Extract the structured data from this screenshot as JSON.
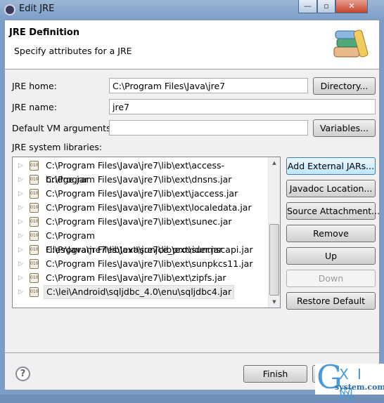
{
  "window": {
    "title": "Edit JRE",
    "controls": [
      "minimize",
      "maximize",
      "close"
    ]
  },
  "header": {
    "title": "JRE Definition",
    "subtitle": "Specify attributes for a JRE",
    "icon": "books-icon"
  },
  "form": {
    "jre_home": {
      "label": "JRE home:",
      "value": "C:\\Program Files\\Java\\jre7",
      "button": "Directory..."
    },
    "jre_name": {
      "label": "JRE name:",
      "value": "jre7"
    },
    "vm_args": {
      "label": "Default VM arguments:",
      "value": "",
      "button": "Variables..."
    },
    "libraries_label": "JRE system libraries:"
  },
  "libraries": [
    "C:\\Program Files\\Java\\jre7\\lib\\ext\\access-bridge.jar",
    "C:\\Program Files\\Java\\jre7\\lib\\ext\\dnsns.jar",
    "C:\\Program Files\\Java\\jre7\\lib\\ext\\jaccess.jar",
    "C:\\Program Files\\Java\\jre7\\lib\\ext\\localedata.jar",
    "C:\\Program Files\\Java\\jre7\\lib\\ext\\sunec.jar",
    "C:\\Program Files\\Java\\jre7\\lib\\ext\\sunjce_provider.jar",
    "C:\\Program Files\\Java\\jre7\\lib\\ext\\sunmscapi.jar",
    "C:\\Program Files\\Java\\jre7\\lib\\ext\\sunpkcs11.jar",
    "C:\\Program Files\\Java\\jre7\\lib\\ext\\zipfs.jar",
    "C:\\lei\\Android\\sqljdbc_4.0\\enu\\sqljdbc4.jar"
  ],
  "jar_icon_text": "010",
  "side_buttons": {
    "add_external": "Add External JARs...",
    "javadoc": "Javadoc Location...",
    "source": "Source Attachment...",
    "remove": "Remove",
    "up": "Up",
    "down": "Down",
    "restore": "Restore Default"
  },
  "footer": {
    "finish": "Finish",
    "help_icon": "?"
  },
  "watermark": {
    "g": "G",
    "xi": "X I 网",
    "site": "system.com"
  }
}
